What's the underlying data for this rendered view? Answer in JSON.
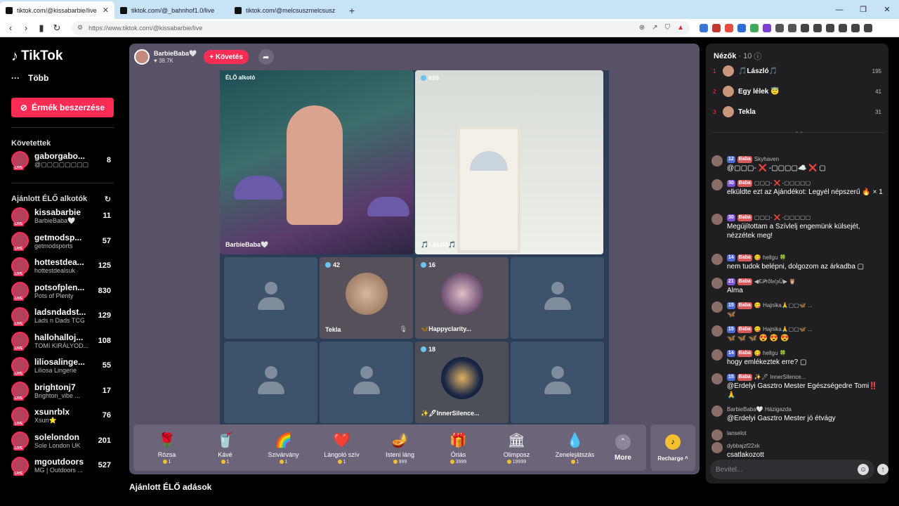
{
  "browser": {
    "tabs": [
      {
        "label": "tiktok.com/@kissabarbie/live",
        "active": true
      },
      {
        "label": "tiktok.com/@_bahnhof1.0/live",
        "active": false
      },
      {
        "label": "tiktok.com/@melcsuszmelcsusz",
        "active": false
      }
    ],
    "url": "https://www.tiktok.com/@kissabarbie/live"
  },
  "sidebar": {
    "logo": "TikTok",
    "more": "Több",
    "coins_button": "Érmék beszerzése",
    "following_heading": "Követettek",
    "following": [
      {
        "name": "gaborgabo...",
        "sub": "@▢▢▢▢▢▢▢▢",
        "count": "8"
      }
    ],
    "suggested_heading": "Ajánlott ÉLŐ alkotók",
    "suggested": [
      {
        "name": "kissabarbie",
        "sub": "BarbieBaba🤍",
        "count": "11"
      },
      {
        "name": "getmodsp...",
        "sub": "getmodsports",
        "count": "57"
      },
      {
        "name": "hottestdea...",
        "sub": "hottestdealsuk",
        "count": "125"
      },
      {
        "name": "potsofplen...",
        "sub": "Pots of Plenty",
        "count": "830"
      },
      {
        "name": "ladsndadst...",
        "sub": "Lads n Dads TCG",
        "count": "129"
      },
      {
        "name": "hallohalloj...",
        "sub": "TOMI KIRÁLYOD...",
        "count": "108"
      },
      {
        "name": "liliosalinge...",
        "sub": "Liliosa Lingerie",
        "count": "55"
      },
      {
        "name": "brightonj7",
        "sub": "Brighton_vibe ...",
        "count": "17"
      },
      {
        "name": "xsunrblx",
        "sub": "Xsun⭐",
        "count": "76"
      },
      {
        "name": "solelondon",
        "sub": "Sole London UK",
        "count": "201"
      },
      {
        "name": "mgoutdoors",
        "sub": "MG | Outdoors ...",
        "count": "527"
      }
    ]
  },
  "stream": {
    "host_name": "BarbieBaba🤍",
    "host_likes": "♥ 38.7K",
    "follow_label": "+ Követés",
    "main_label": "ÉLŐ alkotó",
    "main_name": "BarbieBaba🤍",
    "guest1_count": "699",
    "guest1_name": "🎵László🎵",
    "cells": [
      {
        "count": "42",
        "name": "Tekla"
      },
      {
        "count": "16",
        "name": "🦋Happyclarity..."
      },
      {
        "count": "18",
        "name": "✨🖊InnerSilence..."
      }
    ]
  },
  "gifts": [
    {
      "icon": "🌹",
      "name": "Rózsa",
      "price": "1"
    },
    {
      "icon": "🥤",
      "name": "Kávé",
      "price": "1"
    },
    {
      "icon": "🌈",
      "name": "Szivárvány",
      "price": "1"
    },
    {
      "icon": "❤️",
      "name": "Lángoló szív",
      "price": "1"
    },
    {
      "icon": "🪔",
      "name": "Isteni láng",
      "price": "999"
    },
    {
      "icon": "🎁",
      "name": "Óriás",
      "price": "3999"
    },
    {
      "icon": "🏛",
      "name": "Olimposz",
      "price": "19999"
    },
    {
      "icon": "💧",
      "name": "Zenelejátszás",
      "price": "1"
    }
  ],
  "gifts_more": "More",
  "recharge": "Recharge ^",
  "below_heading": "Ajánlott ÉLŐ adások",
  "chat": {
    "viewers_label": "Nézők",
    "viewers_count": "· 10",
    "top": [
      {
        "rank": "1",
        "name": "🎵László🎵",
        "score": "195"
      },
      {
        "rank": "2",
        "name": "Egy lélek 😇",
        "score": "41"
      },
      {
        "rank": "3",
        "name": "Tekla",
        "score": "31"
      }
    ],
    "messages": [
      {
        "lvl": "12",
        "fan": "Baba",
        "user": "Skyhaven",
        "text": "@▢▢▢- ❌ -▢▢▢▢☁️ ❌ ▢"
      },
      {
        "lvl": "30",
        "fan": "Baba",
        "user": "▢▢▢- ❌ -▢▢▢▢▢",
        "text": "elküldte ezt az Ajándékot: Legyél népszerű 🔥 × 1"
      },
      {
        "lvl": "30",
        "fan": "Baba",
        "user": "▢▢▢- ❌ -▢▢▢▢▢",
        "text": "Megújítottam a Szívlelj engemünk külsejét, nézzétek meg!"
      },
      {
        "lvl": "14",
        "fan": "Baba",
        "user": "😋 hellgu 🍀",
        "text": "nem tudok belépni, dolgozom az árkadba ▢"
      },
      {
        "lvl": "21",
        "fan": "Baba",
        "user": "◀€𝒫rőt𝑒𝑙𝑝Ù▶ 🦉",
        "text": "Alma"
      },
      {
        "lvl": "15",
        "fan": "Baba",
        "user": "😋 Hajnika🙏▢▢🦋 ...",
        "text": "🦋"
      },
      {
        "lvl": "15",
        "fan": "Baba",
        "user": "😋 Hajnika🙏▢▢🦋 ...",
        "text": "🦋 🦋 🦋 😍 😍 😍"
      },
      {
        "lvl": "14",
        "fan": "Baba",
        "user": "😋 hellgu 🍀",
        "text": "hogy emlékeztek erre? ▢"
      },
      {
        "lvl": "15",
        "fan": "Baba",
        "user": "✨🖊 InnerSilence...",
        "text": "@Erdelyi Gasztro Mester Egészségedre Tomi‼️🙏"
      },
      {
        "lvl": "",
        "fan": "",
        "user": "BarbieBaba🤍 Házigazda",
        "text": "@Erdelyi Gasztro Mester jó étvágy"
      },
      {
        "lvl": "",
        "fan": "",
        "user": "lanselot",
        "text": ""
      },
      {
        "lvl": "",
        "fan": "",
        "user": "dybbajzf22xk",
        "text": "csatlakozott"
      }
    ],
    "input_placeholder": "Bevitel..."
  }
}
